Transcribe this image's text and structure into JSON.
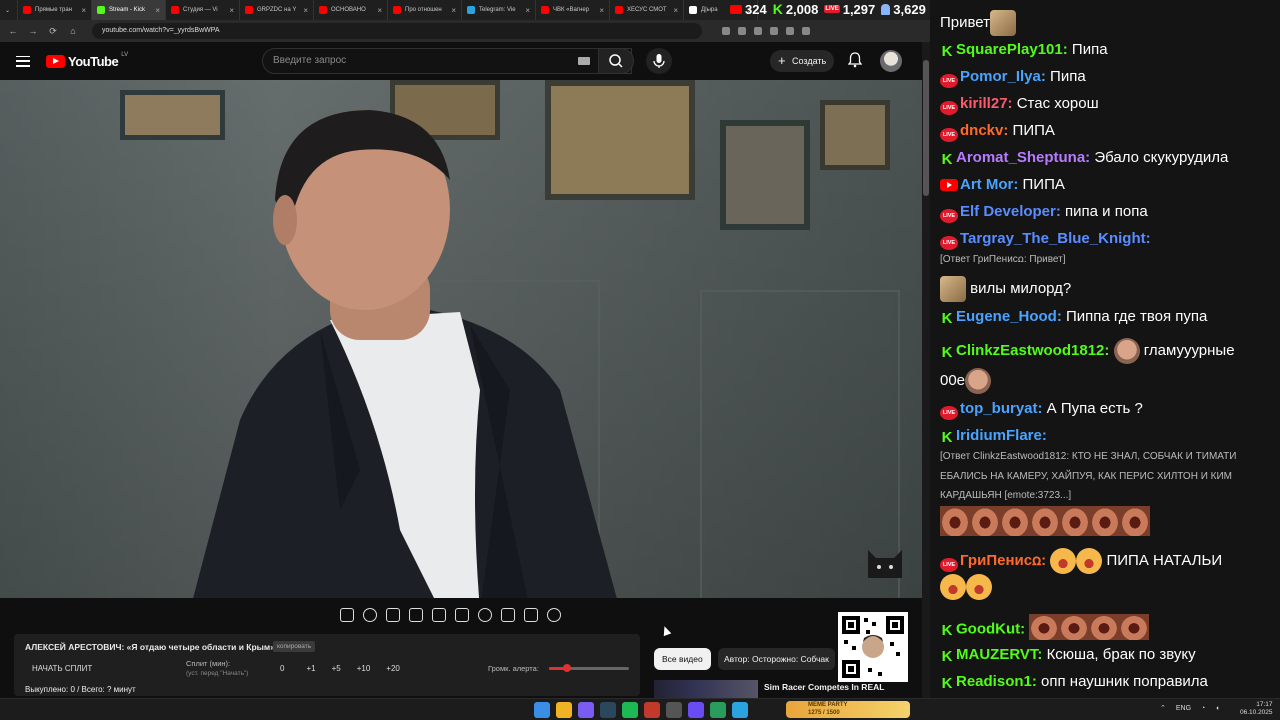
{
  "browser": {
    "tabs": [
      {
        "title": "Прямые тран",
        "color": "#ff0000"
      },
      {
        "title": "Stream - Kick",
        "color": "#53fc18"
      },
      {
        "title": "Студия — Vi",
        "color": "#ff0000"
      },
      {
        "title": "GRPZDC на Y",
        "color": "#ff0000"
      },
      {
        "title": "ОСНОВАНО",
        "color": "#ff0000"
      },
      {
        "title": "Про отношен",
        "color": "#ff0000"
      },
      {
        "title": "Telegram: Vie",
        "color": "#2aa3df"
      },
      {
        "title": "ЧВК «Вагнер",
        "color": "#ff0000"
      },
      {
        "title": "ХЕСУС СМОТ",
        "color": "#ff0000"
      },
      {
        "title": "Д|ыра",
        "color": "#ffffff"
      }
    ],
    "url": "youtube.com/watch?v=_yyrdsBwWPA"
  },
  "stream_stats": {
    "youtube_viewers": "324",
    "kick_viewers": "2,008",
    "vk_viewers": "1,297",
    "total_viewers": "3,629"
  },
  "youtube": {
    "logo_text": "YouTube",
    "country_code": "LV",
    "search_placeholder": "Введите запрос",
    "create_label": "Создать"
  },
  "split_panel": {
    "title": "АЛЕКСЕЙ АРЕСТОВИЧ: «Я отдаю четыре области и Крым»",
    "badge": "копировать",
    "start_label": "НАЧАТЬ СПЛИТ",
    "split_label": "Сплит (мин):",
    "split_hint": "(уст. перед \"Начать\")",
    "split_value": "0",
    "increments": [
      "+1",
      "+5",
      "+10",
      "+20"
    ],
    "volume_label": "Громк. алерта:",
    "volume_level": 0.22,
    "footer": "Выкуплено: 0 / Всего: ? минут"
  },
  "feed": {
    "chip_all": "Все видео",
    "chip_author": "Автор: Осторожно: Собчак",
    "rec_title": "Sim Racer Competes In REAL"
  },
  "chat": [
    {
      "platform": "kick",
      "user": "SquarePlay101:",
      "color": "#53fc18",
      "text": "Пипа"
    },
    {
      "platform": "vk",
      "user": "Pomor_Ilya:",
      "color": "#4aa3ff",
      "text": "Пипа"
    },
    {
      "platform": "vk",
      "user": "kirill27:",
      "color": "#ff5a6e",
      "text": "Стас хорош"
    },
    {
      "platform": "vk",
      "user": "dnckv:",
      "color": "#ff6a2b",
      "text": "ПИПА"
    },
    {
      "platform": "kick",
      "user": "Aromat_Sheptuna:",
      "color": "#b77bff",
      "text": "Эбало скукурудила"
    },
    {
      "platform": "youtube",
      "user": "Art Mor:",
      "color": "#4aa3ff",
      "text": "ПИПА"
    },
    {
      "platform": "vk",
      "user": "Elf Developer:",
      "color": "#5a8dff",
      "text": "пипа и попа"
    },
    {
      "platform": "vk",
      "user": "Targray_The_Blue_Knight:",
      "color": "#5a8dff",
      "text": ""
    },
    {
      "platform": "kick",
      "user": "Eugene_Hood:",
      "color": "#4aa3ff",
      "text": "Пиппа где твоя пупа"
    },
    {
      "platform": "kick",
      "user": "ClinkzEastwood1812:",
      "color": "#53fc18",
      "text": "гламууурные"
    },
    {
      "platform": "vk",
      "user": "top_buryat:",
      "color": "#4aa3ff",
      "text": "А Пупа есть ?"
    },
    {
      "platform": "kick",
      "user": "IridiumFlare:",
      "color": "#4aa3ff",
      "text": ""
    },
    {
      "platform": "vk",
      "user": "ГриПенисꭥ:",
      "color": "#ff6a2b",
      "text": "ПИПА НАТАЛЬИ"
    },
    {
      "platform": "kick",
      "user": "GoodKut:",
      "color": "#53fc18",
      "text": ""
    },
    {
      "platform": "kick",
      "user": "MAUZERVT:",
      "color": "#53fc18",
      "text": "Ксюша, брак по звуку"
    },
    {
      "platform": "kick",
      "user": "Readison1:",
      "color": "#53fc18",
      "text": "опп наушник поправила"
    }
  ],
  "chat_extra": {
    "top_text": "Привет",
    "targray_reply": "[Ответ ГриПенисꭥ: Привет]",
    "targray_text": "вилы милорд?",
    "clinkz_cont": "00е",
    "iridium_reply_1": "[Ответ ClinkzEastwood1812: КТО НЕ ЗНАЛ, СОБЧАК И ТИМАТИ",
    "iridium_reply_2": "ЕБАЛИСЬ НА КАМЕРУ, ХАЙПУЯ, КАК ПЕРИС ХИЛТОН И КИМ",
    "iridium_reply_3": "КАРДАШЬЯН [emote:3723...]"
  },
  "taskbar": {
    "widget_title": "MEME PARTY",
    "widget_progress": "1275 / 1500",
    "lang": "ENG",
    "time": "17:17",
    "date": "06.10.2025"
  }
}
